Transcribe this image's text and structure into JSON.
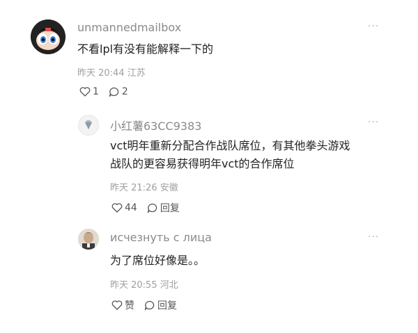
{
  "comments": [
    {
      "username": "unmannedmailbox",
      "text": "不看lpl有没有能解释一下的",
      "time_location": "昨天 20:44 江苏",
      "likes": "1",
      "replies": "2"
    },
    {
      "username": "小红薯63CC9383",
      "text_line1": "vct明年重新分配合作战队席位，有其他拳头游戏",
      "text_line2": "战队的更容易获得明年vct的合作席位",
      "time_location": "昨天 21:26 安徽",
      "likes": "44",
      "reply_label": "回复"
    },
    {
      "username": "исчезнуть с лица",
      "text": "为了席位好像是。。",
      "time_location": "昨天 20:55 河北",
      "like_label": "赞",
      "reply_label": "回复"
    }
  ],
  "more_symbol": "···",
  "colors": {
    "text": "#222222",
    "meta": "#9e9e9e",
    "username": "#8a8a8a"
  }
}
